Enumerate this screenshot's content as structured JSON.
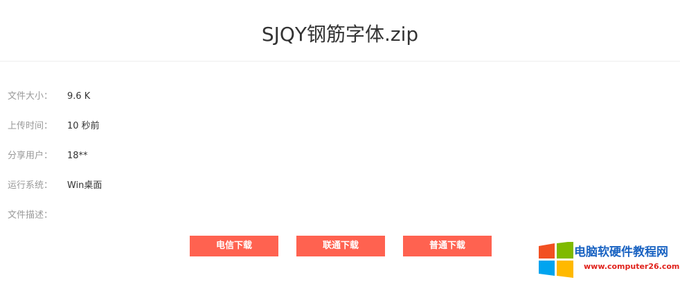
{
  "header": {
    "title": "SJQY钢筋字体.zip"
  },
  "info": {
    "size_label": "文件大小：",
    "size_value": "9.6 K",
    "time_label": "上传时间：",
    "time_value": "10 秒前",
    "user_label": "分享用户：",
    "user_value": "18**",
    "os_label": "运行系统：",
    "os_value": "Win桌面",
    "desc_label": "文件描述：",
    "desc_value": ""
  },
  "buttons": {
    "telecom": "电信下载",
    "unicom": "联通下载",
    "normal": "普通下载"
  },
  "watermark": {
    "site_name": "电脑软硬件教程网",
    "site_url": "www.computer26.com"
  },
  "colors": {
    "button": "#ff6250",
    "title_text": "#333333",
    "label_text": "#999999"
  }
}
